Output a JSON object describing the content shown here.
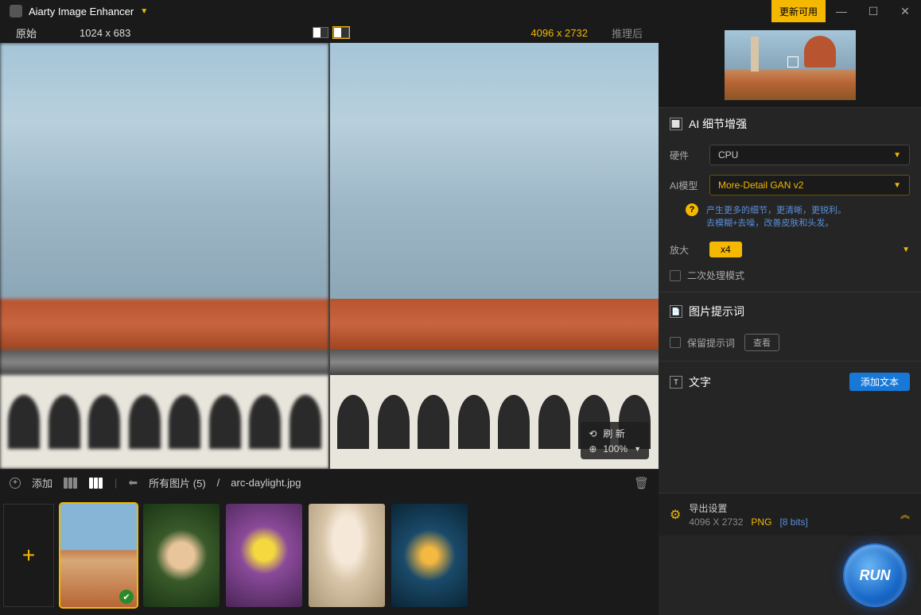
{
  "titlebar": {
    "appName": "Aiarty Image Enhancer",
    "update": "更新可用"
  },
  "infobar": {
    "origLabel": "原始",
    "origDims": "1024 x 683",
    "outDims": "4096 x 2732",
    "postLabel": "推理后"
  },
  "zoom": {
    "refresh": "刷  新",
    "percent": "100%"
  },
  "crumb": {
    "add": "添加",
    "allLabel": "所有图片",
    "count": "(5)",
    "filename": "arc-daylight.jpg"
  },
  "panel": {
    "aiTitle": "AI 细节增强",
    "hwLabel": "硬件",
    "hwValue": "CPU",
    "modelLabel": "AI模型",
    "modelValue": "More-Detail GAN v2",
    "modelDesc1": "产生更多的细节，更清晰，更锐利。",
    "modelDesc2": "去模糊+去噪，改善皮肤和头发。",
    "scaleLabel": "放大",
    "scaleValue": "x4",
    "secondPass": "二次处理模式",
    "promptTitle": "图片提示词",
    "keepPrompt": "保留提示词",
    "viewBtn": "查看",
    "textTitle": "文字",
    "addText": "添加文本"
  },
  "export": {
    "title": "导出设置",
    "dims": "4096 X 2732",
    "format": "PNG",
    "bits": "[8 bits]"
  },
  "run": "RUN"
}
